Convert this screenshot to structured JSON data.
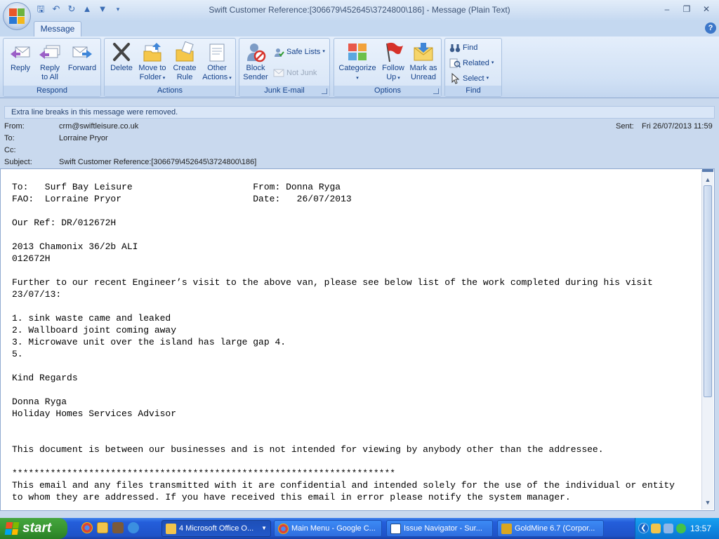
{
  "window": {
    "title": "Swift Customer Reference:[306679\\452645\\3724800\\186] - Message (Plain Text)"
  },
  "tabs": {
    "message": "Message"
  },
  "ribbon": {
    "respond": {
      "label": "Respond",
      "reply": "Reply",
      "reply_all_1": "Reply",
      "reply_all_2": "to All",
      "forward": "Forward"
    },
    "actions": {
      "label": "Actions",
      "delete": "Delete",
      "move_1": "Move to",
      "move_2": "Folder",
      "create_1": "Create",
      "create_2": "Rule",
      "other_1": "Other",
      "other_2": "Actions"
    },
    "junk": {
      "label": "Junk E-mail",
      "block_1": "Block",
      "block_2": "Sender",
      "safe_lists": "Safe Lists",
      "not_junk": "Not Junk"
    },
    "options": {
      "label": "Options",
      "categorize": "Categorize",
      "follow_1": "Follow",
      "follow_2": "Up",
      "mark_1": "Mark as",
      "mark_2": "Unread"
    },
    "find": {
      "label": "Find",
      "find": "Find",
      "related": "Related",
      "select": "Select"
    }
  },
  "infobar": "Extra line breaks in this message were removed.",
  "header": {
    "from_label": "From:",
    "from": "crm@swiftleisure.co.uk",
    "to_label": "To:",
    "to": "Lorraine Pryor",
    "cc_label": "Cc:",
    "cc": "",
    "subject_label": "Subject:",
    "subject": "Swift Customer Reference:[306679\\452645\\3724800\\186]",
    "sent_label": "Sent:",
    "sent": "Fri 26/07/2013 11:59"
  },
  "body": "To:   Surf Bay Leisure                      From: Donna Ryga\nFAO:  Lorraine Pryor                        Date:   26/07/2013\n\nOur Ref: DR/012672H\n\n2013 Chamonix 36/2b ALI\n012672H\n\nFurther to our recent Engineer’s visit to the above van, please see below list of the work completed during his visit\n23/07/13:\n\n1. sink waste came and leaked\n2. Wallboard joint coming away\n3. Microwave unit over the island has large gap 4.\n5.\n\nKind Regards\n\nDonna Ryga\nHoliday Homes Services Advisor\n\n\nThis document is between our businesses and is not intended for viewing by anybody other than the addressee.\n\n**********************************************************************\nThis email and any files transmitted with it are confidential and intended solely for the use of the individual or entity\nto whom they are addressed. If you have received this email in error please notify the system manager.",
  "taskbar": {
    "start": "start",
    "tasks": [
      "4 Microsoft Office O...",
      "Main Menu - Google C...",
      "Issue Navigator - Sur...",
      "GoldMine 6.7 (Corpor..."
    ],
    "clock": "13:57"
  }
}
